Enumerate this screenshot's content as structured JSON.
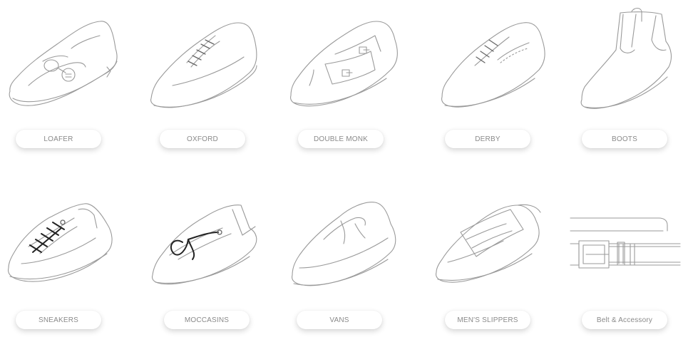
{
  "categories": [
    {
      "label": "LOAFER",
      "icon": "loafer-shoe-icon"
    },
    {
      "label": "OXFORD",
      "icon": "oxford-shoe-icon"
    },
    {
      "label": "DOUBLE MONK",
      "icon": "double-monk-shoe-icon"
    },
    {
      "label": "DERBY",
      "icon": "derby-shoe-icon"
    },
    {
      "label": "BOOTS",
      "icon": "boots-icon"
    },
    {
      "label": "SNEAKERS",
      "icon": "sneakers-icon"
    },
    {
      "label": "MOCCASINS",
      "icon": "moccasins-icon"
    },
    {
      "label": "VANS",
      "icon": "vans-shoe-icon"
    },
    {
      "label": "MEN'S SLIPPERS",
      "icon": "mens-slippers-icon"
    },
    {
      "label": "Belt & Accessory",
      "icon": "belt-icon"
    }
  ],
  "colors": {
    "line": "#9a9a9a",
    "label_text": "#8a8a8a",
    "lace_dark": "#222222"
  }
}
